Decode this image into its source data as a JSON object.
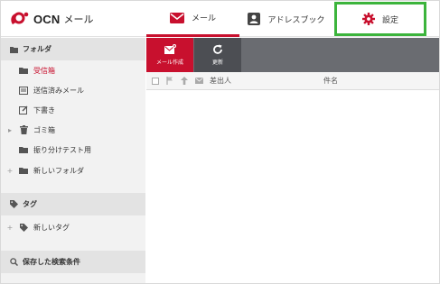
{
  "header": {
    "logo_text": "OCN",
    "logo_sub": "メール",
    "tabs": [
      {
        "label": "メール",
        "icon": "envelope-icon",
        "active": true
      },
      {
        "label": "アドレスブック",
        "icon": "address-book-icon",
        "active": false
      },
      {
        "label": "設定",
        "icon": "gear-icon",
        "active": false
      }
    ]
  },
  "sidebar": {
    "folder_section": "フォルダ",
    "items": [
      {
        "label": "受信箱",
        "icon": "folder-icon",
        "active": true
      },
      {
        "label": "送信済みメール",
        "icon": "sent-icon"
      },
      {
        "label": "下書き",
        "icon": "draft-icon"
      },
      {
        "label": "ゴミ箱",
        "icon": "trash-icon",
        "expander": "▸"
      },
      {
        "label": "振り分けテスト用",
        "icon": "folder-icon"
      },
      {
        "label": "新しいフォルダ",
        "icon": "folder-icon",
        "expander": "+"
      }
    ],
    "tag_section": "タグ",
    "tag_items": [
      {
        "label": "新しいタグ",
        "icon": "tag-icon",
        "expander": "+"
      }
    ],
    "search_section": "保存した検索条件"
  },
  "toolbar": {
    "compose_label": "メール作成",
    "refresh_label": "更新"
  },
  "list": {
    "col_from": "差出人",
    "col_subject": "件名"
  },
  "colors": {
    "brand_red": "#c8102e",
    "highlight_green": "#3cb43c",
    "toolbar_gray": "#6a6c71"
  }
}
